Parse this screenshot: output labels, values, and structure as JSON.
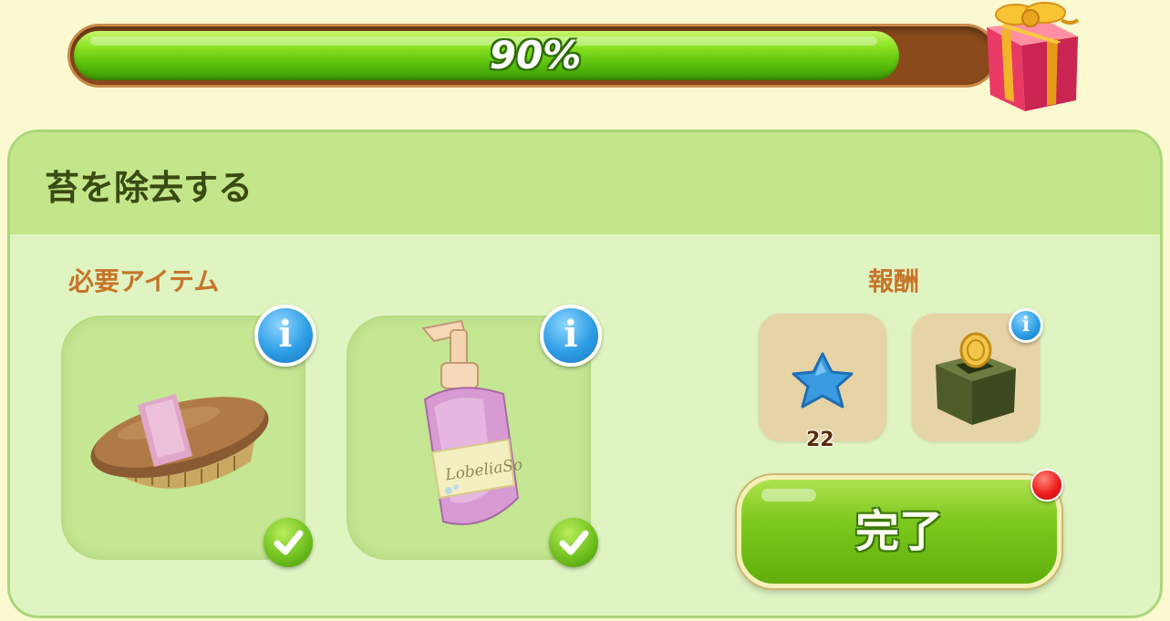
{
  "progress": {
    "label": "90%",
    "fraction": 0.9
  },
  "task": {
    "title": "苔を除去する"
  },
  "required": {
    "label": "必要アイテム",
    "items": [
      {
        "icon": "brush-icon",
        "info_icon": "info-icon",
        "status_icon": "check-icon"
      },
      {
        "icon": "soap-bottle-icon",
        "bottle_text": "LobeliaSo",
        "info_icon": "info-icon",
        "status_icon": "check-icon"
      }
    ]
  },
  "reward": {
    "label": "報酬",
    "items": [
      {
        "icon": "blue-star-icon",
        "count": "22"
      },
      {
        "icon": "coin-box-icon",
        "info_icon": "info-icon"
      }
    ]
  },
  "complete_button": {
    "label": "完了",
    "has_notification": true
  },
  "colors": {
    "background": "#fbf9d0",
    "panel": "#e0f4c2",
    "header": "#c3e68a",
    "accent_green": "#7dc91e",
    "label_orange": "#c6752a"
  }
}
